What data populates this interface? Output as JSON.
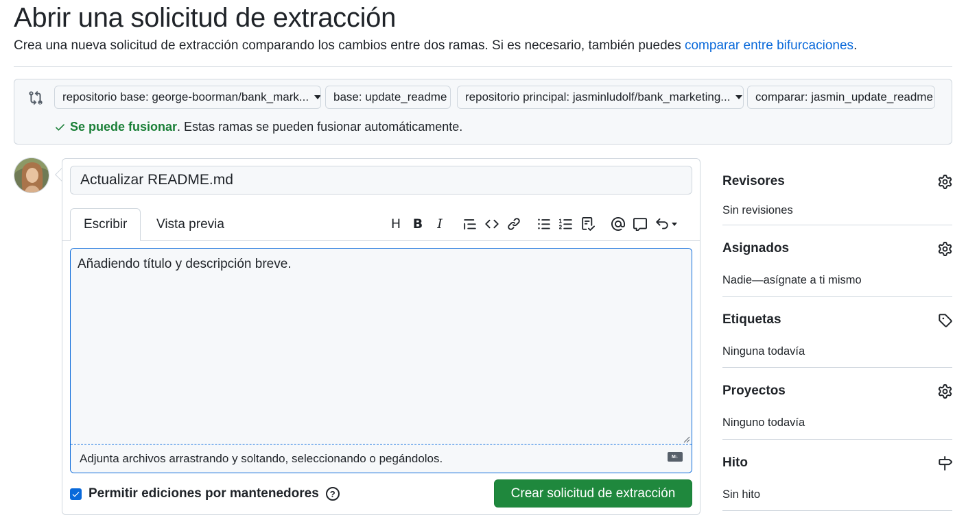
{
  "header": {
    "title": "Abrir una solicitud de extracción",
    "subtitle_text": "Crea una nueva solicitud de extracción comparando los cambios entre dos ramas. Si es necesario, también puedes ",
    "subtitle_link": "comparar entre bifurcaciones",
    "subtitle_end": "."
  },
  "compare": {
    "base_repo": "repositorio base: george-boorman/bank_mark...",
    "base_branch": "base: update_readme",
    "head_repo": "repositorio principal: jasminludolf/bank_marketing...",
    "compare_branch": "comparar: jasmin_update_readme",
    "status_ok": "Se puede fusionar",
    "status_text": ". Estas ramas se pueden fusionar automáticamente.",
    "status_color": "#1a7f37"
  },
  "form": {
    "title_value": "Actualizar README.md",
    "tabs": [
      {
        "label": "Escribir",
        "active": true
      },
      {
        "label": "Vista previa",
        "active": false
      }
    ],
    "toolbar_icons": [
      "heading-icon",
      "bold-icon",
      "italic-icon",
      "quote-icon",
      "code-icon",
      "link-icon",
      "unordered-list-icon",
      "ordered-list-icon",
      "task-list-icon",
      "mention-icon",
      "reference-icon",
      "undo-icon"
    ],
    "toolbar_heading": "H",
    "toolbar_bold": "B",
    "toolbar_italic": "I",
    "body_value": "Añadiendo título y descripción breve.",
    "attach_hint": "Adjunta archivos arrastrando y soltando, seleccionando o pegándolos.",
    "maintainer_label": "Permitir ediciones por mantenedores",
    "maintainer_checked": true,
    "submit_label": "Crear solicitud de extracción",
    "submit_color": "#1f883d"
  },
  "sidebar": {
    "sections": [
      {
        "title": "Revisores",
        "value": "Sin revisiones",
        "icon": "gear-icon"
      },
      {
        "title": "Asignados",
        "value": "Nadie—asígnate a ti mismo",
        "icon": "gear-icon"
      },
      {
        "title": "Etiquetas",
        "value": "Ninguna todavía",
        "icon": "tag-icon"
      },
      {
        "title": "Proyectos",
        "value": "Ninguno todavía",
        "icon": "gear-icon"
      },
      {
        "title": "Hito",
        "value": "Sin hito",
        "icon": "milestone-icon"
      }
    ]
  }
}
